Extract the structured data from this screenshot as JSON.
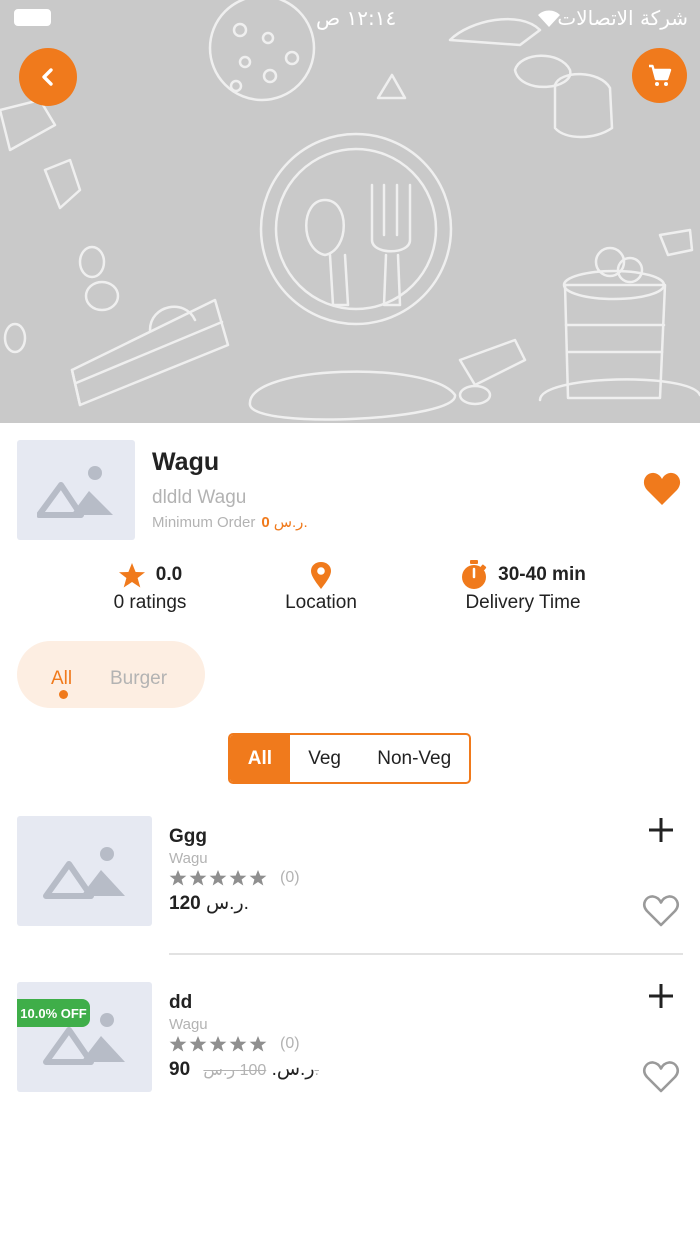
{
  "status_bar": {
    "time": "١٢:١٤ ص",
    "carrier": "شركة الاتصالات"
  },
  "restaurant": {
    "name": "Wagu",
    "subtitle": "dldld Wagu",
    "min_order_label": "Minimum Order",
    "min_order_value": "0",
    "currency": "ر.س.",
    "rating": "0.0",
    "ratings_label": "0 ratings",
    "location_label": "Location",
    "delivery_time": "30-40 min",
    "delivery_label": "Delivery Time"
  },
  "categories": {
    "items": [
      "All",
      "Burger"
    ],
    "selected": "All"
  },
  "filter": {
    "options": [
      "All",
      "Veg",
      "Non-Veg"
    ],
    "selected": "All"
  },
  "products": [
    {
      "name": "Ggg",
      "restaurant": "Wagu",
      "rating_count": "(0)",
      "price": "120",
      "currency": "ر.س.",
      "old_price": "",
      "old_currency": "",
      "discount": ""
    },
    {
      "name": "dd",
      "restaurant": "Wagu",
      "rating_count": "(0)",
      "price": "90",
      "currency": "ر.س.",
      "old_price": "100",
      "old_currency": "ر.س.",
      "discount": "10.0% OFF"
    }
  ],
  "colors": {
    "accent": "#f07a1c",
    "discount_badge": "#3fae49",
    "hero_background": "#c9c9c9",
    "placeholder": "#e6e9f2",
    "muted_text": "#b3b3b3"
  },
  "icons": {
    "back": "chevron-left-icon",
    "cart": "cart-icon",
    "favorite_filled": "heart-filled-icon",
    "favorite_outline": "heart-outline-icon",
    "rating": "star-icon",
    "location": "location-pin-icon",
    "delivery": "stopwatch-icon",
    "add": "plus-icon",
    "image_placeholder": "image-placeholder-icon"
  }
}
